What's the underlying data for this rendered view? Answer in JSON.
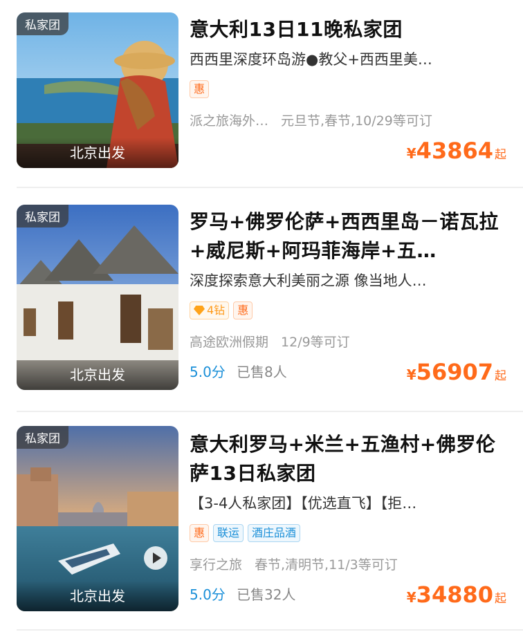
{
  "items": [
    {
      "thumb_tag": "私家团",
      "departure": "北京出发",
      "title": "意大利13日11晚私家团",
      "subtitle": "西西里深度环岛游●教父+西西里美…",
      "badges": [
        "惠"
      ],
      "agency": "派之旅海外…",
      "dates": "元旦节,春节,10/29等可订",
      "price_symbol": "¥",
      "price": "43864",
      "price_suffix": "起"
    },
    {
      "thumb_tag": "私家团",
      "departure": "北京出发",
      "title": "罗马+佛罗伦萨+西西里岛－诺瓦拉+威尼斯+阿玛菲海岸+五…",
      "subtitle": "深度探索意大利美丽之源 像当地人…",
      "diamond_badge": "4钻",
      "badges": [
        "惠"
      ],
      "agency": "高途欧洲假期",
      "dates": "12/9等可订",
      "score": "5.0分",
      "sold": "已售8人",
      "price_symbol": "¥",
      "price": "56907",
      "price_suffix": "起"
    },
    {
      "thumb_tag": "私家团",
      "departure": "北京出发",
      "title": "意大利罗马+米兰+五渔村+佛罗伦萨13日私家团",
      "subtitle": "【3-4人私家团】【优选直飞】【拒…",
      "badges": [
        "惠",
        "联运",
        "酒庄品酒"
      ],
      "agency": "享行之旅",
      "dates": "春节,清明节,11/3等可订",
      "score": "5.0分",
      "sold": "已售32人",
      "price_symbol": "¥",
      "price": "34880",
      "price_suffix": "起"
    }
  ],
  "colors": {
    "price": "#ff6a1a",
    "score": "#1a8fd8",
    "meta": "#999999"
  },
  "icons": {
    "play": "play-icon",
    "diamond": "diamond-icon"
  }
}
